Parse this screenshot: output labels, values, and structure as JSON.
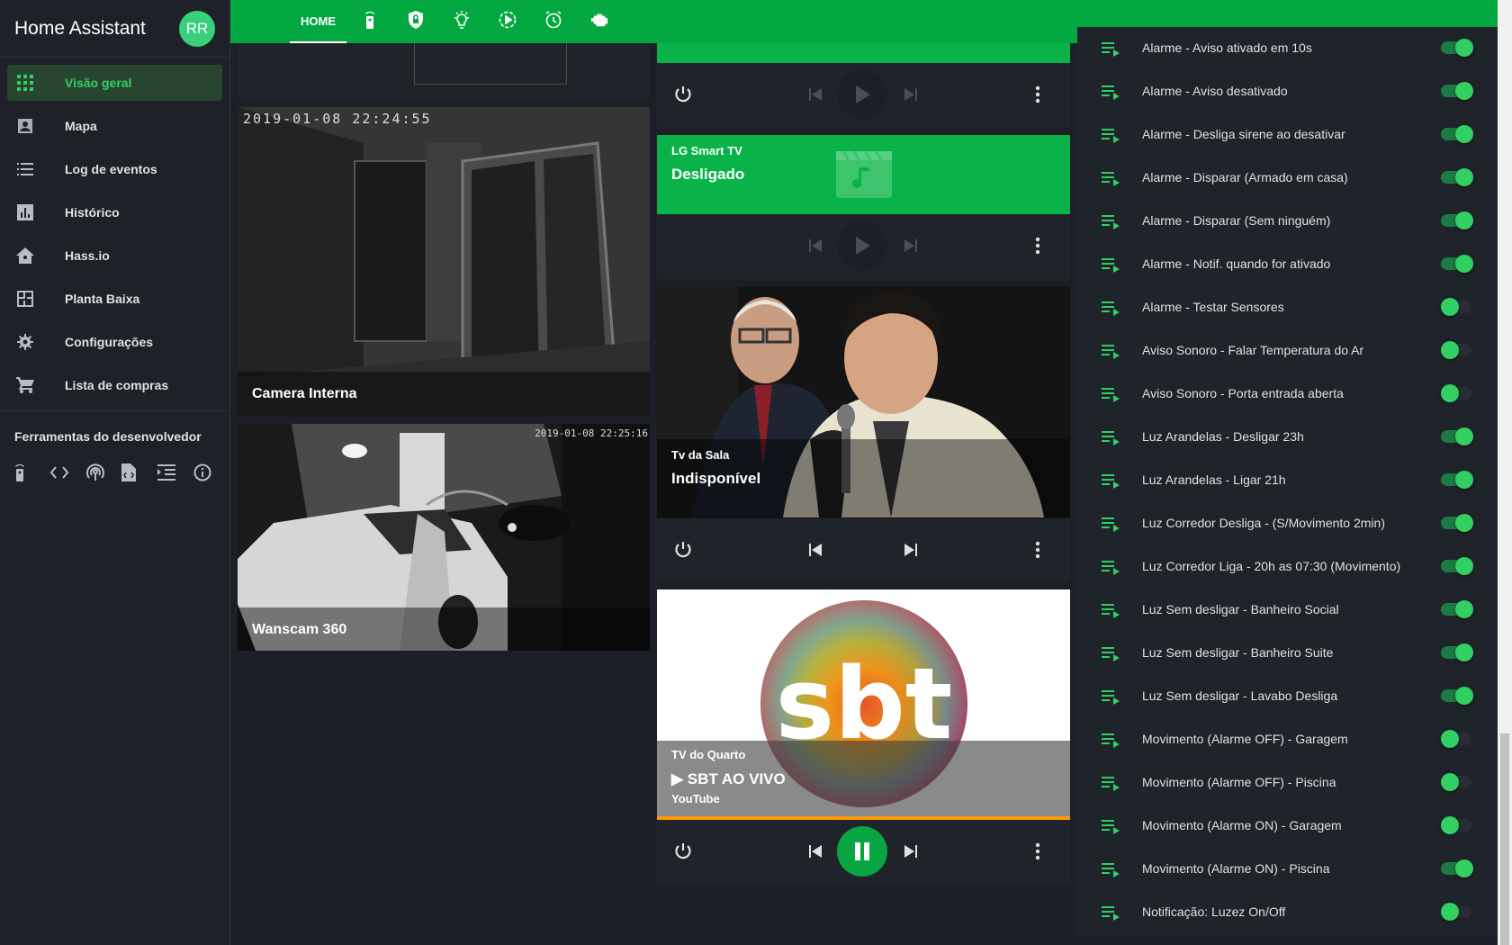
{
  "sidebar": {
    "title": "Home Assistant",
    "avatar": "RR",
    "items": [
      {
        "label": "Visão geral",
        "icon": "grid-icon"
      },
      {
        "label": "Mapa",
        "icon": "account-box-icon"
      },
      {
        "label": "Log de eventos",
        "icon": "list-icon"
      },
      {
        "label": "Histórico",
        "icon": "chart-icon"
      },
      {
        "label": "Hass.io",
        "icon": "home-assistant-icon"
      },
      {
        "label": "Planta Baixa",
        "icon": "floorplan-icon"
      },
      {
        "label": "Configurações",
        "icon": "gear-icon"
      },
      {
        "label": "Lista de compras",
        "icon": "cart-icon"
      }
    ],
    "dev_tools_title": "Ferramentas do desenvolvedor",
    "dev_tools": [
      "remote-icon",
      "code-icon",
      "broadcast-icon",
      "file-code-icon",
      "template-icon",
      "info-icon"
    ]
  },
  "topbar": {
    "home_label": "HOME",
    "tabs": [
      "remote-icon",
      "shield-lock-icon",
      "lightbulb-icon",
      "motion-play-icon",
      "alarm-icon",
      "engine-icon"
    ]
  },
  "cameras": [
    {
      "name": "Camera Interna",
      "timestamp": "2019-01-08  22:24:55"
    },
    {
      "name": "Wanscam 360",
      "timestamp": "2019-01-08 22:25:16"
    }
  ],
  "media": {
    "lg": {
      "label": "LG Smart TV",
      "state": "Desligado"
    },
    "sala": {
      "label": "Tv da Sala",
      "state": "Indisponível"
    },
    "quarto": {
      "label": "TV do Quarto",
      "title": "▶ SBT AO VIVO",
      "app": "YouTube",
      "logo_text": "sbt",
      "progress": 1.0
    }
  },
  "colors": {
    "accent": "#03a940",
    "toggle_on": "#32d063",
    "progress": "#ff9800"
  },
  "automations": [
    {
      "label": "Alarme - Aviso ativado em 10s",
      "on": true
    },
    {
      "label": "Alarme - Aviso desativado",
      "on": true
    },
    {
      "label": "Alarme - Desliga sirene ao desativar",
      "on": true
    },
    {
      "label": "Alarme - Disparar (Armado em casa)",
      "on": true
    },
    {
      "label": "Alarme - Disparar (Sem ninguém)",
      "on": true
    },
    {
      "label": "Alarme - Notif. quando for ativado",
      "on": true
    },
    {
      "label": "Alarme - Testar Sensores",
      "on": false
    },
    {
      "label": "Aviso Sonoro - Falar Temperatura do Ar",
      "on": false
    },
    {
      "label": "Aviso Sonoro - Porta entrada aberta",
      "on": false
    },
    {
      "label": "Luz Arandelas - Desligar 23h",
      "on": true
    },
    {
      "label": "Luz Arandelas - Ligar 21h",
      "on": true
    },
    {
      "label": "Luz Corredor Desliga - (S/Movimento 2min)",
      "on": true
    },
    {
      "label": "Luz Corredor Liga - 20h as 07:30 (Movimento)",
      "on": true
    },
    {
      "label": "Luz Sem desligar - Banheiro Social",
      "on": true
    },
    {
      "label": "Luz Sem desligar - Banheiro Suite",
      "on": true
    },
    {
      "label": "Luz Sem desligar - Lavabo Desliga",
      "on": true
    },
    {
      "label": "Movimento (Alarme OFF) - Garagem",
      "on": false
    },
    {
      "label": "Movimento (Alarme OFF) - Piscina",
      "on": false
    },
    {
      "label": "Movimento (Alarme ON) - Garagem",
      "on": false
    },
    {
      "label": "Movimento (Alarme ON) - Piscina",
      "on": true
    },
    {
      "label": "Notificação: Luzez On/Off",
      "on": false
    }
  ]
}
